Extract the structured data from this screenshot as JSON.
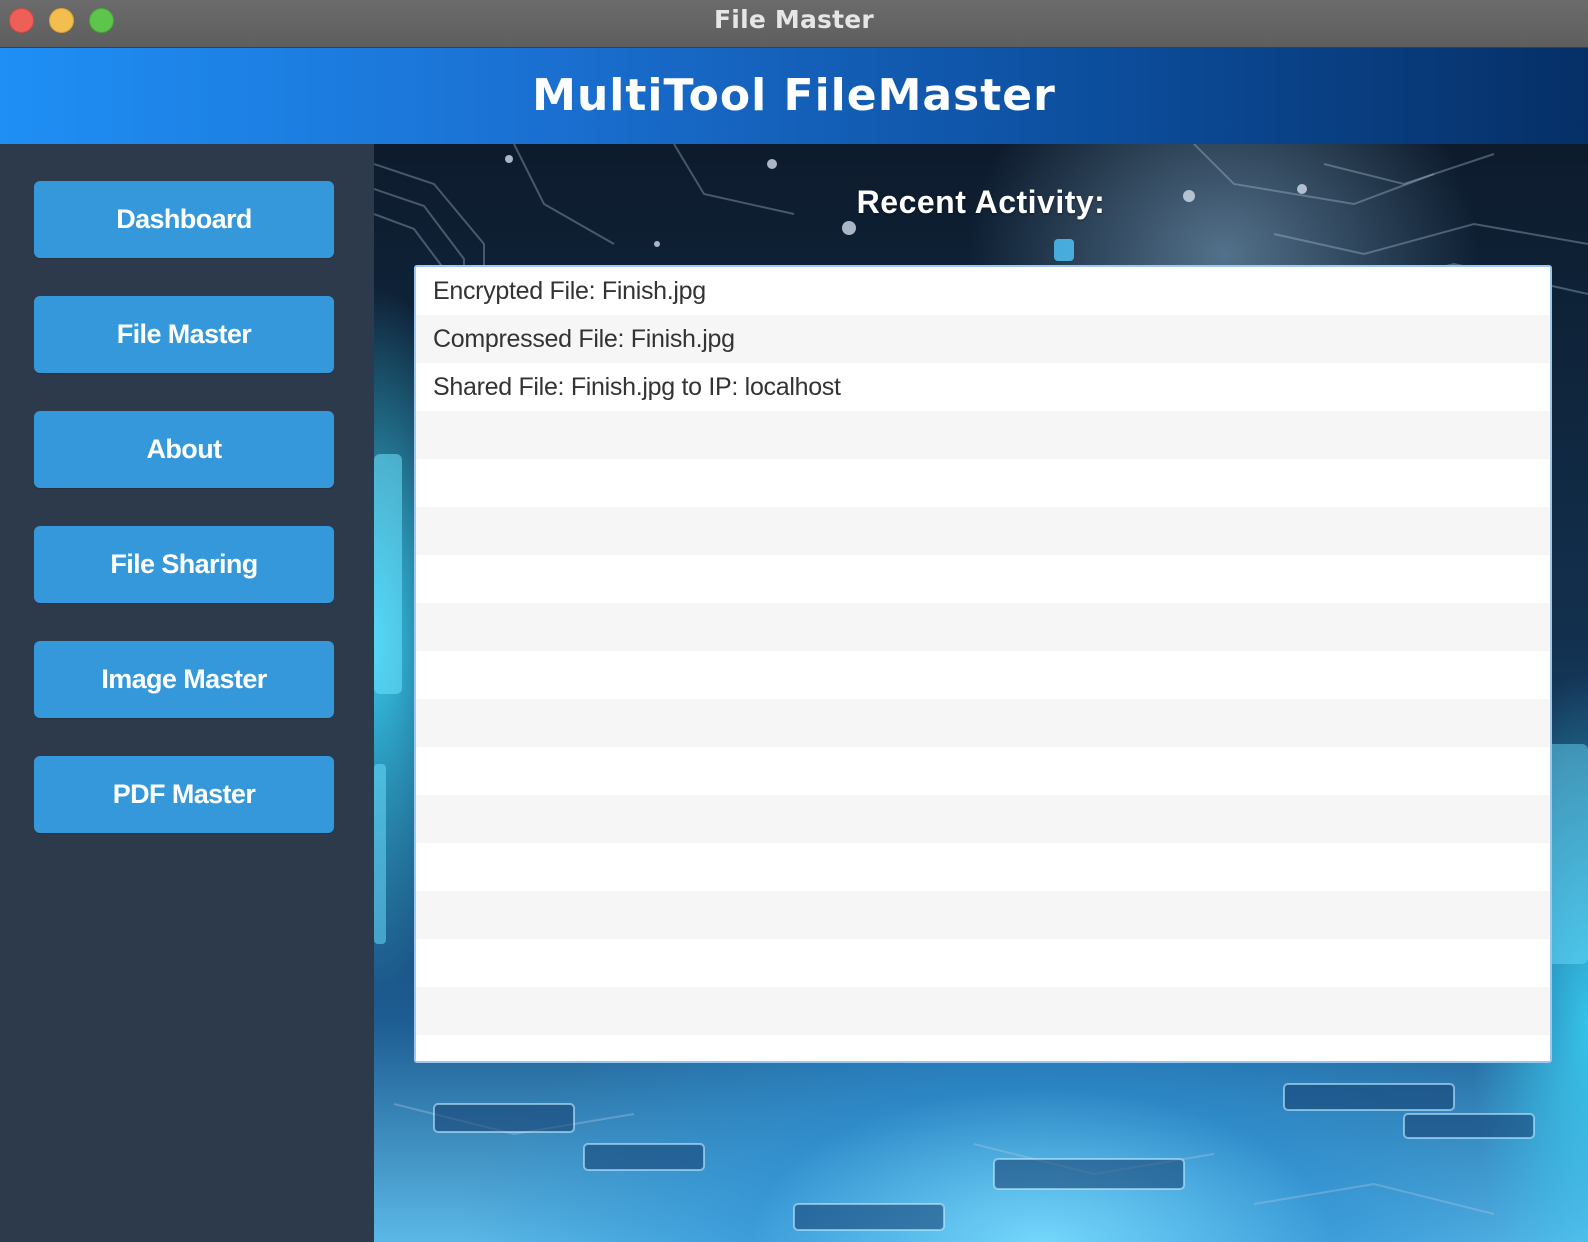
{
  "window": {
    "title": "File Master"
  },
  "header": {
    "title": "MultiTool FileMaster"
  },
  "sidebar": {
    "items": [
      {
        "label": "Dashboard"
      },
      {
        "label": "File Master"
      },
      {
        "label": "About"
      },
      {
        "label": "File Sharing"
      },
      {
        "label": "Image Master"
      },
      {
        "label": "PDF Master"
      }
    ]
  },
  "main": {
    "section_title": "Recent Activity:",
    "activity": [
      "Encrypted File: Finish.jpg",
      "Compressed File: Finish.jpg",
      "Shared File: Finish.jpg to IP: localhost",
      "",
      "",
      "",
      "",
      "",
      "",
      "",
      "",
      "",
      "",
      "",
      "",
      "",
      ""
    ]
  },
  "colors": {
    "sidebar_bg": "#2c3a4b",
    "button_bg": "#3498db",
    "header_gradient_start": "#1f8ff5",
    "header_gradient_end": "#062f66"
  }
}
